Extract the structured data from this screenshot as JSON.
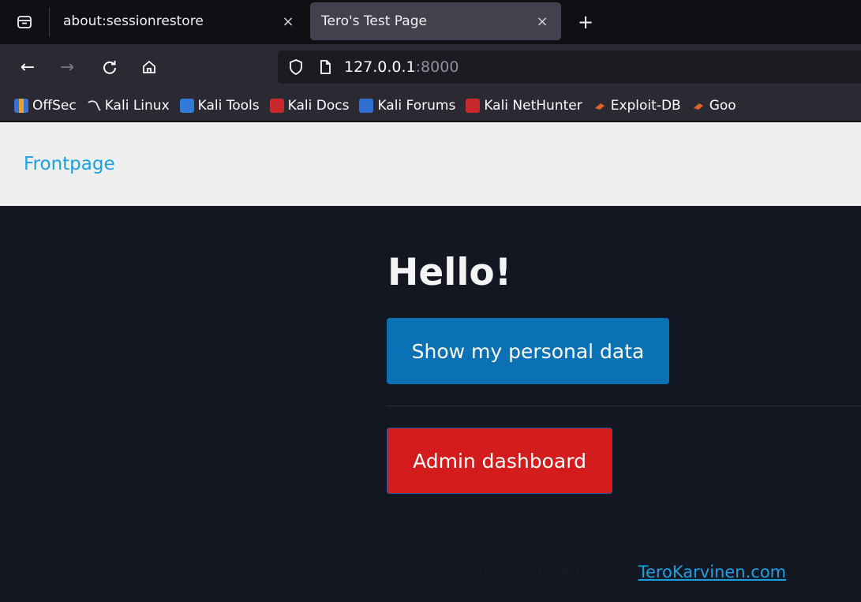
{
  "browser": {
    "tabs": [
      {
        "title": "about:sessionrestore",
        "close": "×"
      },
      {
        "title": "Tero's Test Page",
        "close": "×"
      }
    ],
    "new_tab": "+",
    "nav": {
      "back": "←",
      "forward": "→",
      "reload": "C",
      "home": "⌂"
    },
    "url": {
      "host": "127.0.0.1",
      "port": ":8000"
    },
    "bookmarks": [
      "OffSec",
      "Kali Linux",
      "Kali Tools",
      "Kali Docs",
      "Kali Forums",
      "Kali NetHunter",
      "Exploit-DB",
      "Goo"
    ]
  },
  "page": {
    "nav_link": "Frontpage",
    "heading": "Hello!",
    "personal_button": "Show my personal data",
    "admin_button": "Admin dashboard",
    "footer_text": "Copyright 2024 Tero Karvinen",
    "footer_link": "TeroKarvinen.com"
  },
  "colors": {
    "link": "#1ba1e2",
    "primary_button": "#0a72b4",
    "danger_button": "#d41c1c",
    "page_bg": "#131722",
    "nav_bg": "#efefef"
  }
}
